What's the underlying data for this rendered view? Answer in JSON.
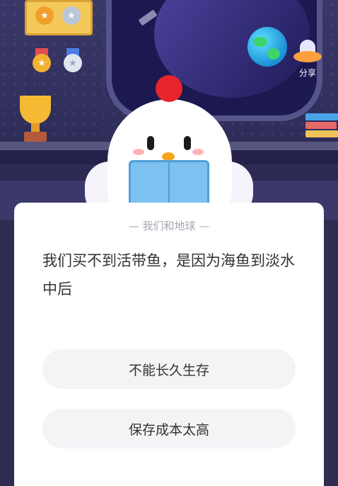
{
  "scene": {
    "share_label": "分享",
    "icons": [
      "medal-gold-icon",
      "medal-silver-icon",
      "trophy-icon",
      "earth-icon",
      "satellite-icon",
      "ufo-icon",
      "books-icon"
    ]
  },
  "quiz": {
    "category": "— 我们和地球 —",
    "question": "我们买不到活带鱼，是因为海鱼到淡水中后",
    "options": [
      {
        "label": "不能长久生存"
      },
      {
        "label": "保存成本太高"
      }
    ]
  },
  "colors": {
    "background_dark": "#2f2d52",
    "card": "#ffffff",
    "option_bg": "#f3f4f6",
    "text_main": "#333333",
    "text_muted": "#a3a8b4",
    "comb_red": "#e8252c"
  }
}
